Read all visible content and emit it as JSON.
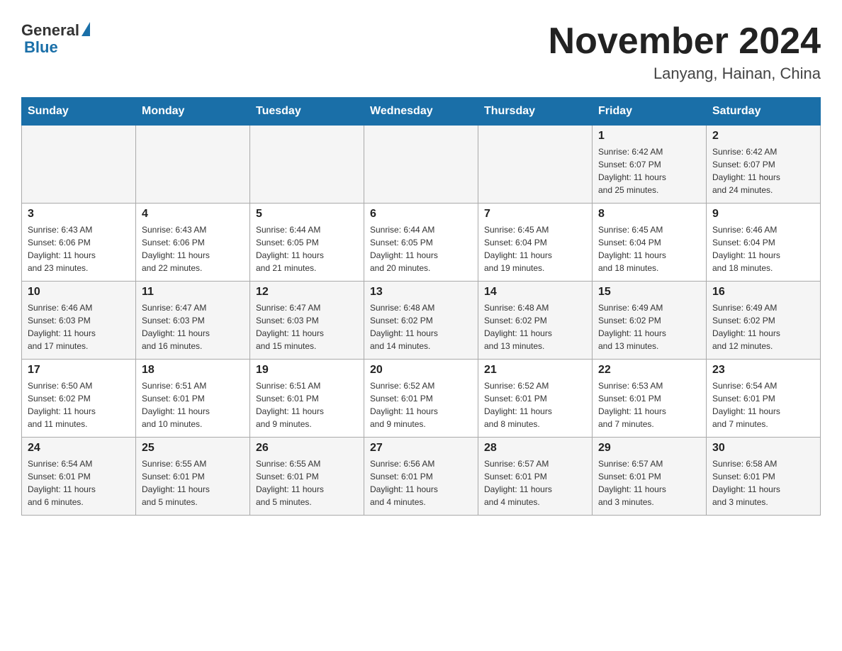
{
  "header": {
    "logo": {
      "general": "General",
      "blue": "Blue"
    },
    "title": "November 2024",
    "subtitle": "Lanyang, Hainan, China"
  },
  "calendar": {
    "days_of_week": [
      "Sunday",
      "Monday",
      "Tuesday",
      "Wednesday",
      "Thursday",
      "Friday",
      "Saturday"
    ],
    "weeks": [
      [
        {
          "day": "",
          "info": ""
        },
        {
          "day": "",
          "info": ""
        },
        {
          "day": "",
          "info": ""
        },
        {
          "day": "",
          "info": ""
        },
        {
          "day": "",
          "info": ""
        },
        {
          "day": "1",
          "info": "Sunrise: 6:42 AM\nSunset: 6:07 PM\nDaylight: 11 hours\nand 25 minutes."
        },
        {
          "day": "2",
          "info": "Sunrise: 6:42 AM\nSunset: 6:07 PM\nDaylight: 11 hours\nand 24 minutes."
        }
      ],
      [
        {
          "day": "3",
          "info": "Sunrise: 6:43 AM\nSunset: 6:06 PM\nDaylight: 11 hours\nand 23 minutes."
        },
        {
          "day": "4",
          "info": "Sunrise: 6:43 AM\nSunset: 6:06 PM\nDaylight: 11 hours\nand 22 minutes."
        },
        {
          "day": "5",
          "info": "Sunrise: 6:44 AM\nSunset: 6:05 PM\nDaylight: 11 hours\nand 21 minutes."
        },
        {
          "day": "6",
          "info": "Sunrise: 6:44 AM\nSunset: 6:05 PM\nDaylight: 11 hours\nand 20 minutes."
        },
        {
          "day": "7",
          "info": "Sunrise: 6:45 AM\nSunset: 6:04 PM\nDaylight: 11 hours\nand 19 minutes."
        },
        {
          "day": "8",
          "info": "Sunrise: 6:45 AM\nSunset: 6:04 PM\nDaylight: 11 hours\nand 18 minutes."
        },
        {
          "day": "9",
          "info": "Sunrise: 6:46 AM\nSunset: 6:04 PM\nDaylight: 11 hours\nand 18 minutes."
        }
      ],
      [
        {
          "day": "10",
          "info": "Sunrise: 6:46 AM\nSunset: 6:03 PM\nDaylight: 11 hours\nand 17 minutes."
        },
        {
          "day": "11",
          "info": "Sunrise: 6:47 AM\nSunset: 6:03 PM\nDaylight: 11 hours\nand 16 minutes."
        },
        {
          "day": "12",
          "info": "Sunrise: 6:47 AM\nSunset: 6:03 PM\nDaylight: 11 hours\nand 15 minutes."
        },
        {
          "day": "13",
          "info": "Sunrise: 6:48 AM\nSunset: 6:02 PM\nDaylight: 11 hours\nand 14 minutes."
        },
        {
          "day": "14",
          "info": "Sunrise: 6:48 AM\nSunset: 6:02 PM\nDaylight: 11 hours\nand 13 minutes."
        },
        {
          "day": "15",
          "info": "Sunrise: 6:49 AM\nSunset: 6:02 PM\nDaylight: 11 hours\nand 13 minutes."
        },
        {
          "day": "16",
          "info": "Sunrise: 6:49 AM\nSunset: 6:02 PM\nDaylight: 11 hours\nand 12 minutes."
        }
      ],
      [
        {
          "day": "17",
          "info": "Sunrise: 6:50 AM\nSunset: 6:02 PM\nDaylight: 11 hours\nand 11 minutes."
        },
        {
          "day": "18",
          "info": "Sunrise: 6:51 AM\nSunset: 6:01 PM\nDaylight: 11 hours\nand 10 minutes."
        },
        {
          "day": "19",
          "info": "Sunrise: 6:51 AM\nSunset: 6:01 PM\nDaylight: 11 hours\nand 9 minutes."
        },
        {
          "day": "20",
          "info": "Sunrise: 6:52 AM\nSunset: 6:01 PM\nDaylight: 11 hours\nand 9 minutes."
        },
        {
          "day": "21",
          "info": "Sunrise: 6:52 AM\nSunset: 6:01 PM\nDaylight: 11 hours\nand 8 minutes."
        },
        {
          "day": "22",
          "info": "Sunrise: 6:53 AM\nSunset: 6:01 PM\nDaylight: 11 hours\nand 7 minutes."
        },
        {
          "day": "23",
          "info": "Sunrise: 6:54 AM\nSunset: 6:01 PM\nDaylight: 11 hours\nand 7 minutes."
        }
      ],
      [
        {
          "day": "24",
          "info": "Sunrise: 6:54 AM\nSunset: 6:01 PM\nDaylight: 11 hours\nand 6 minutes."
        },
        {
          "day": "25",
          "info": "Sunrise: 6:55 AM\nSunset: 6:01 PM\nDaylight: 11 hours\nand 5 minutes."
        },
        {
          "day": "26",
          "info": "Sunrise: 6:55 AM\nSunset: 6:01 PM\nDaylight: 11 hours\nand 5 minutes."
        },
        {
          "day": "27",
          "info": "Sunrise: 6:56 AM\nSunset: 6:01 PM\nDaylight: 11 hours\nand 4 minutes."
        },
        {
          "day": "28",
          "info": "Sunrise: 6:57 AM\nSunset: 6:01 PM\nDaylight: 11 hours\nand 4 minutes."
        },
        {
          "day": "29",
          "info": "Sunrise: 6:57 AM\nSunset: 6:01 PM\nDaylight: 11 hours\nand 3 minutes."
        },
        {
          "day": "30",
          "info": "Sunrise: 6:58 AM\nSunset: 6:01 PM\nDaylight: 11 hours\nand 3 minutes."
        }
      ]
    ]
  }
}
